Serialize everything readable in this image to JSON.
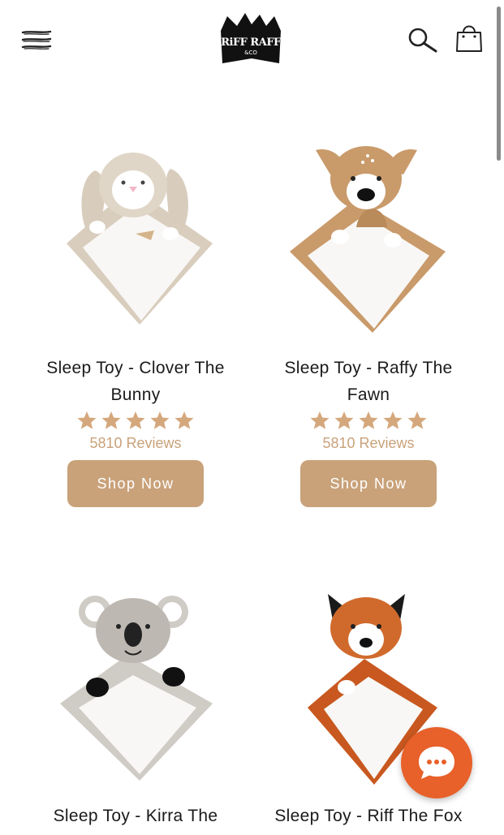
{
  "header": {
    "menu_icon": "hamburger-menu-icon",
    "logo": {
      "line1": "RiFF RAFF",
      "line2": "&CO"
    },
    "search_icon": "search-icon",
    "bag_icon": "shopping-bag-icon"
  },
  "colors": {
    "accent": "#c9a27a",
    "chat": "#e8602a",
    "text": "#1a1a1a"
  },
  "products": [
    {
      "title_line1": "Sleep Toy - Clover The",
      "title_line2": "Bunny",
      "rating": 5,
      "reviews": "5810 Reviews",
      "button": "Shop Now",
      "image": "bunny-sleep-toy"
    },
    {
      "title_line1": "Sleep Toy - Raffy The",
      "title_line2": "Fawn",
      "rating": 5,
      "reviews": "5810 Reviews",
      "button": "Shop Now",
      "image": "fawn-sleep-toy"
    },
    {
      "title_line1": "Sleep Toy - Kirra The",
      "image": "koala-sleep-toy"
    },
    {
      "title_line1": "Sleep Toy - Riff The Fox",
      "image": "fox-sleep-toy"
    }
  ],
  "chat": {
    "icon": "chat-bubble-icon"
  }
}
